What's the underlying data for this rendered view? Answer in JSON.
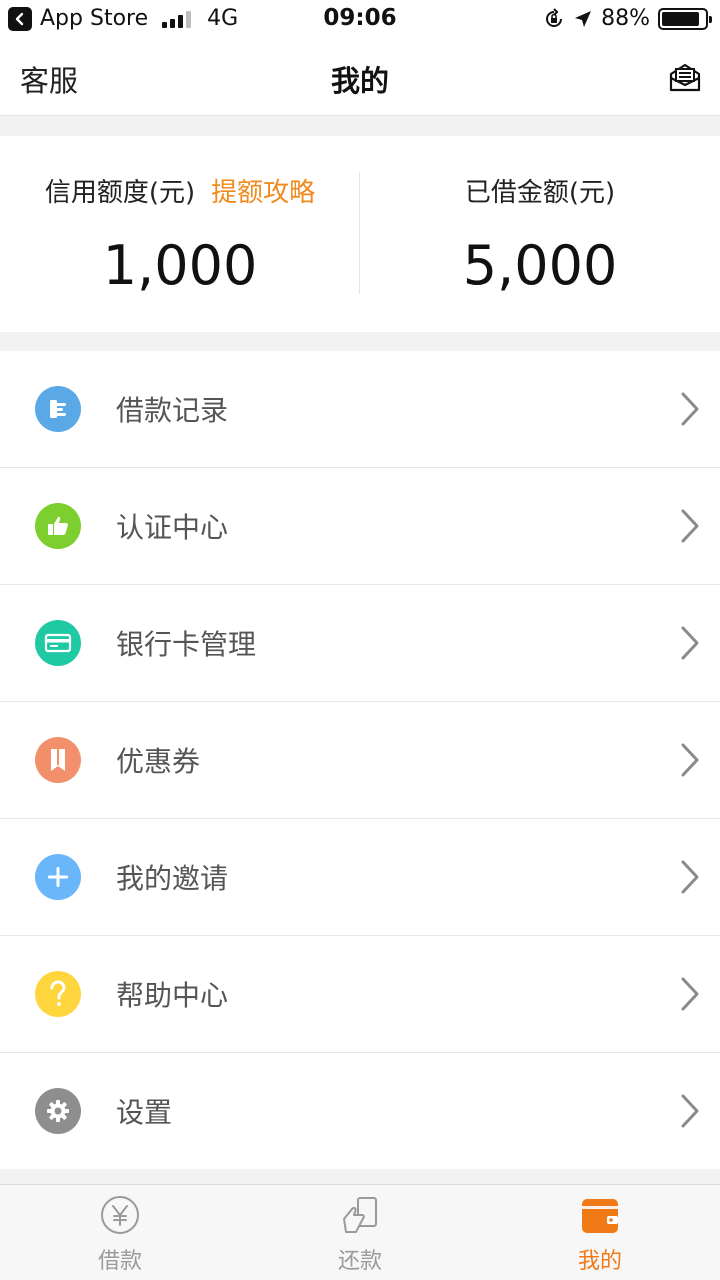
{
  "status_bar": {
    "back_app": "App Store",
    "network": "4G",
    "time": "09:06",
    "battery": "88%",
    "battery_level": 0.88
  },
  "nav": {
    "left": "客服",
    "title": "我的"
  },
  "summary": {
    "credit_label": "信用额度(元)",
    "credit_link": "提额攻略",
    "credit_value": "1,000",
    "borrowed_label": "已借金额(元)",
    "borrowed_value": "5,000"
  },
  "menu": {
    "items": [
      {
        "label": "借款记录",
        "icon": "records-icon",
        "color": "#5aa9e6"
      },
      {
        "label": "认证中心",
        "icon": "thumbs-up-icon",
        "color": "#7ccf2e"
      },
      {
        "label": "银行卡管理",
        "icon": "bank-card-icon",
        "color": "#1ec9a4"
      },
      {
        "label": "优惠券",
        "icon": "coupon-icon",
        "color": "#f3906c"
      },
      {
        "label": "我的邀请",
        "icon": "plus-icon",
        "color": "#6ab6fb"
      },
      {
        "label": "帮助中心",
        "icon": "question-icon",
        "color": "#ffd53d"
      },
      {
        "label": "设置",
        "icon": "gear-icon",
        "color": "#8e8e8e"
      }
    ]
  },
  "tabs": {
    "items": [
      {
        "label": "借款",
        "icon": "yen-coin-icon"
      },
      {
        "label": "还款",
        "icon": "repay-icon"
      },
      {
        "label": "我的",
        "icon": "wallet-icon"
      }
    ],
    "active_color": "#f07a16",
    "inactive_color": "#9a9a9a"
  }
}
